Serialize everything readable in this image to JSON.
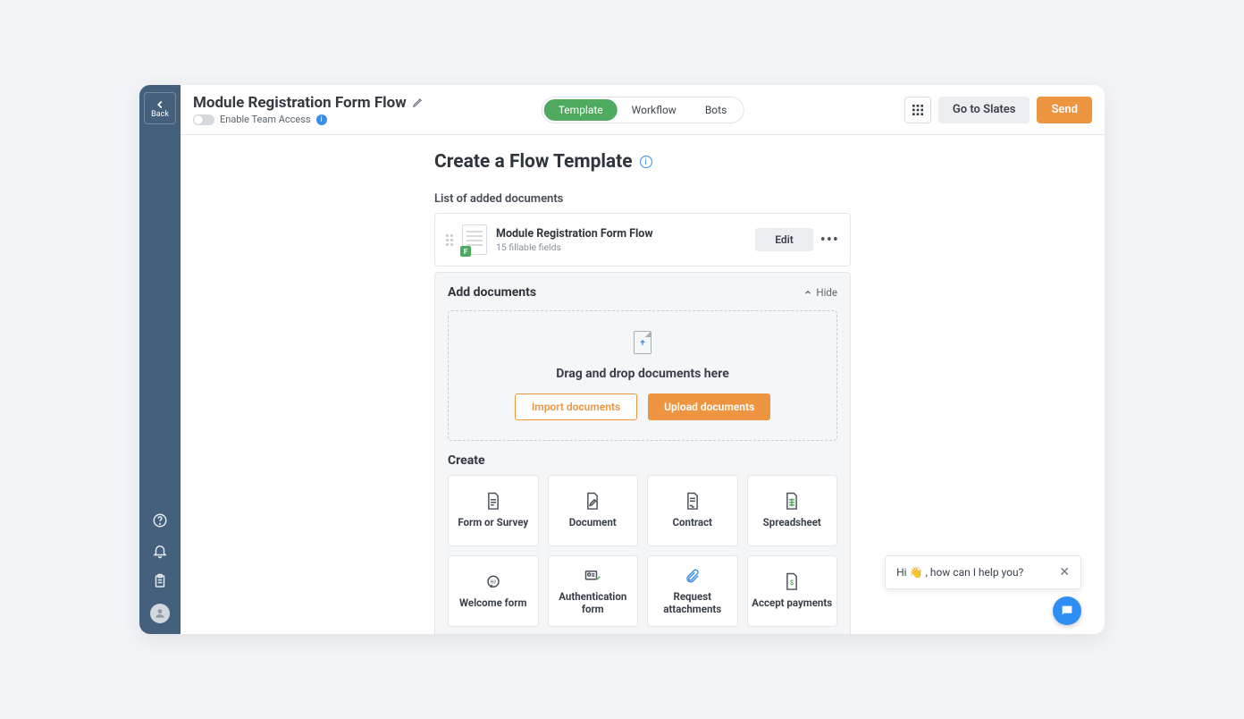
{
  "back_label": "Back",
  "title": "Module Registration Form Flow",
  "team_access_label": "Enable Team Access",
  "tabs": {
    "template": "Template",
    "workflow": "Workflow",
    "bots": "Bots"
  },
  "actions": {
    "slates": "Go to Slates",
    "send": "Send"
  },
  "heading": "Create a Flow Template",
  "list_heading": "List of added documents",
  "document": {
    "title": "Module Registration Form Flow",
    "subtitle": "15 fillable fields",
    "edit": "Edit"
  },
  "add_section": {
    "title": "Add documents",
    "hide": "Hide"
  },
  "dropzone": {
    "text": "Drag and drop documents here",
    "import": "Import documents",
    "upload": "Upload documents"
  },
  "create_heading": "Create",
  "cards": {
    "form": "Form or Survey",
    "document": "Document",
    "contract": "Contract",
    "spreadsheet": "Spreadsheet",
    "welcome": "Welcome form",
    "auth": "Authentication form",
    "attachments": "Request attachments",
    "payments": "Accept payments"
  },
  "chat": {
    "text": "Hi 👋 , how can I help you?"
  }
}
